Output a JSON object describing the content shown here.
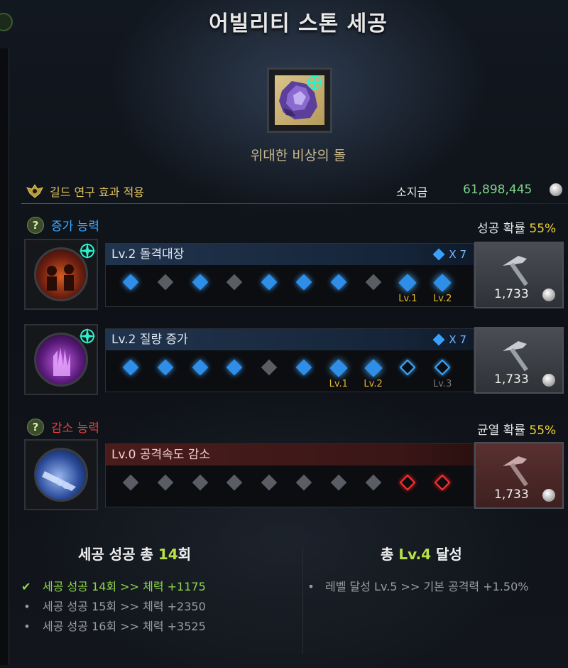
{
  "header": {
    "title": "어빌리티 스톤 세공"
  },
  "stone": {
    "name": "위대한 비상의 돌",
    "icon": "amethyst-stone-icon"
  },
  "guild": {
    "label": "길드 연구 효과 적용"
  },
  "money": {
    "label": "소지금",
    "value": "61,898,445"
  },
  "increase": {
    "section_label": "증가 능력",
    "prob_label": "성공 확률",
    "prob_value": "55%",
    "abilities": [
      {
        "name": "Lv.2 돌격대장",
        "multiplier": "X 7",
        "cost": "1,733",
        "slots": [
          "success",
          "fail",
          "success",
          "fail",
          "success",
          "success",
          "success",
          "fail",
          "level",
          "level"
        ],
        "slot_labels": [
          "",
          "",
          "",
          "",
          "",
          "",
          "",
          "",
          "Lv.1",
          "Lv.2"
        ]
      },
      {
        "name": "Lv.2 질량 증가",
        "multiplier": "X 7",
        "cost": "1,733",
        "slots": [
          "success",
          "success",
          "success",
          "success",
          "fail",
          "success",
          "level",
          "level",
          "empty",
          "empty"
        ],
        "slot_labels": [
          "",
          "",
          "",
          "",
          "",
          "",
          "Lv.1",
          "Lv.2",
          "",
          "Lv.3"
        ]
      }
    ]
  },
  "decrease": {
    "section_label": "감소 능력",
    "prob_label": "균열 확률",
    "prob_value": "55%",
    "abilities": [
      {
        "name": "Lv.0 공격속도 감소",
        "cost": "1,733",
        "slots": [
          "fail",
          "fail",
          "fail",
          "fail",
          "fail",
          "fail",
          "fail",
          "fail",
          "empty",
          "empty"
        ]
      }
    ]
  },
  "summary_left": {
    "title_prefix": "세공 성공 총 ",
    "title_count": "14",
    "title_suffix": "회",
    "items": [
      {
        "text": "세공 성공 14회 >> 체력 +1175",
        "achieved": true
      },
      {
        "text": "세공 성공 15회 >> 체력 +2350",
        "achieved": false
      },
      {
        "text": "세공 성공 16회 >> 체력 +3525",
        "achieved": false
      }
    ]
  },
  "summary_right": {
    "title_prefix": "총 ",
    "title_level": "Lv.4",
    "title_suffix": " 달성",
    "items": [
      {
        "text": "레벨 달성 Lv.5 >> 기본 공격력 +1.50%"
      }
    ]
  },
  "colors": {
    "gold": "#e0c158",
    "success_green": "#7fd38a",
    "prob_yellow": "#f0d23c",
    "increase_blue": "#3fa8ff",
    "decrease_red": "#e04040"
  }
}
